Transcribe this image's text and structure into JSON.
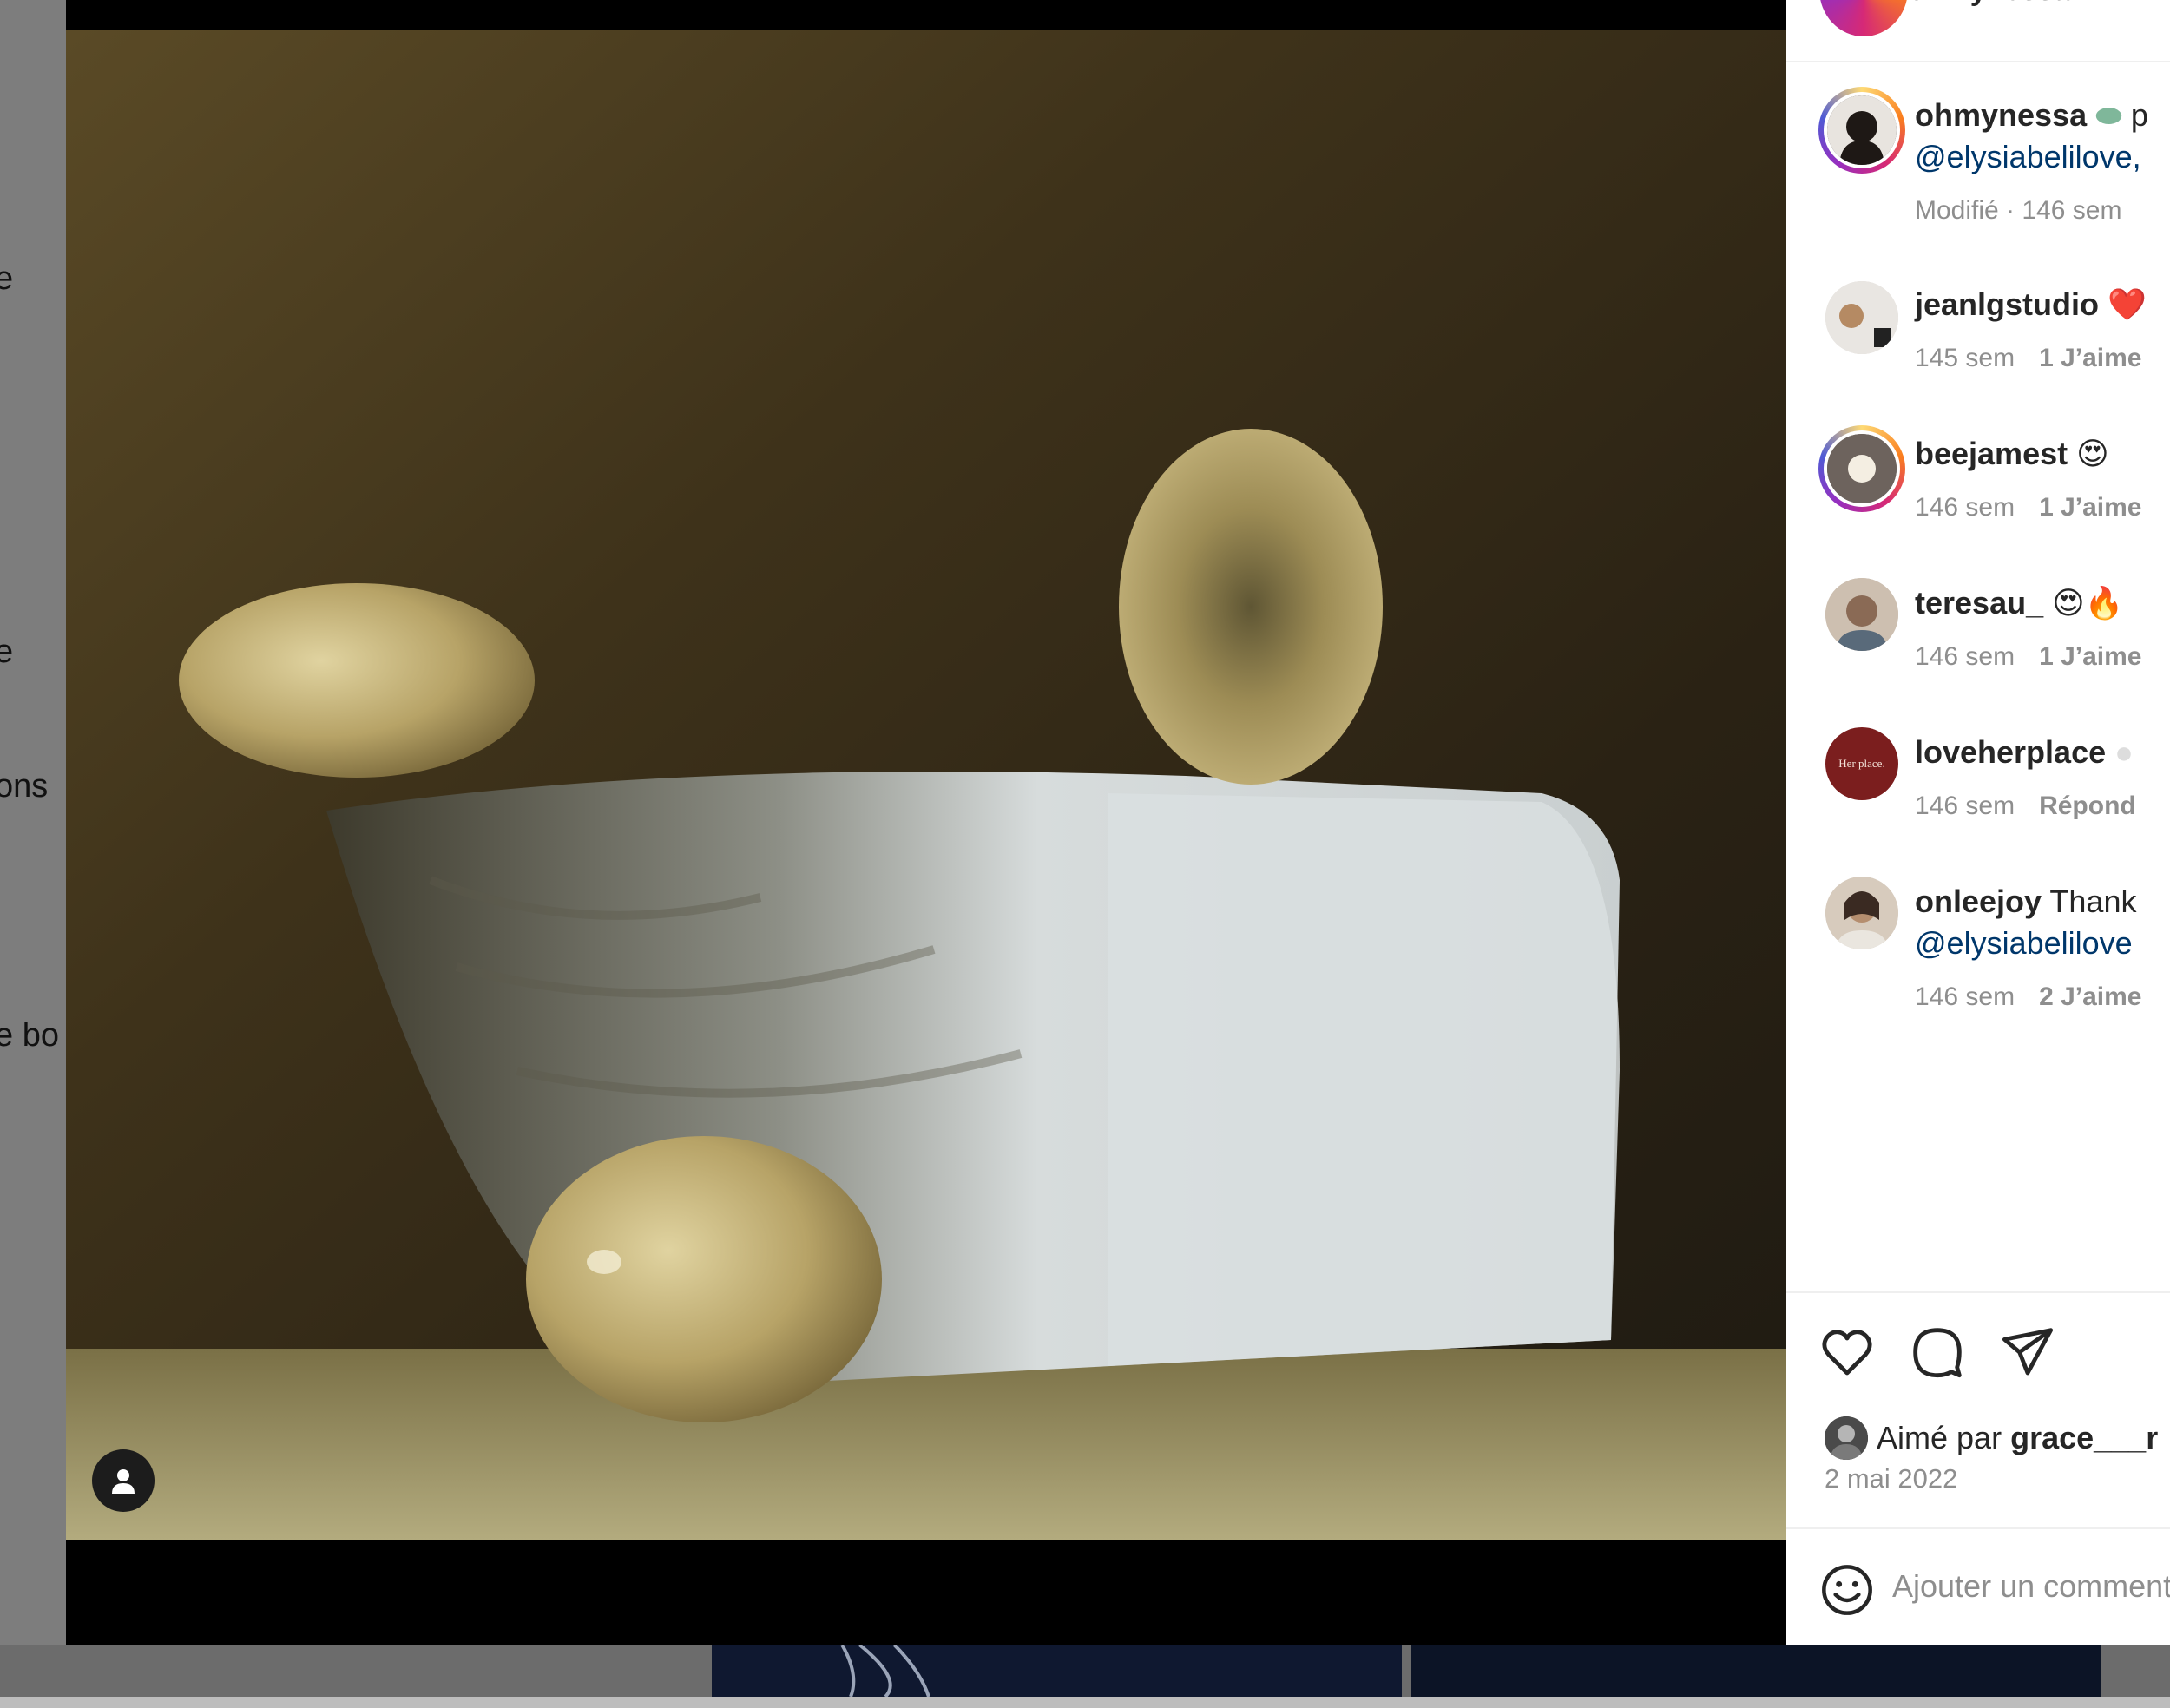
{
  "background": {
    "snippets": [
      "e",
      "e",
      "ons",
      "e bo"
    ]
  },
  "header": {
    "username": "ohmynessa"
  },
  "caption": {
    "username": "ohmynessa",
    "text_tail": "p",
    "mention": "@elysiabelilove,",
    "meta": "Modifié · 146 sem"
  },
  "comments": [
    {
      "username": "jeanlgstudio",
      "emoji": "❤️",
      "time": "145 sem",
      "action": "1 J’aime"
    },
    {
      "username": "beejamest",
      "emoji": "😍",
      "time": "146 sem",
      "action": "1 J’aime"
    },
    {
      "username": "teresau_",
      "emoji": "😍🔥",
      "time": "146 sem",
      "action": "1 J’aime"
    },
    {
      "username": "loveherplace",
      "emoji": "",
      "time": "146 sem",
      "action": "Répond",
      "avatar_text": "Her place."
    },
    {
      "username": "onleejoy",
      "text": "Thank",
      "mention": "@elysiabelilove",
      "time": "146 sem",
      "action": "2 J’aime"
    }
  ],
  "likes": {
    "prefix": "Aimé par",
    "user": "grace___r"
  },
  "post_date": "2 mai 2022",
  "add_comment": {
    "placeholder": "Ajouter un commentaire…"
  },
  "colors": {
    "ring_gradient": [
      "#feda75",
      "#fa7e1e",
      "#d62976",
      "#962fbf"
    ],
    "mention": "#00376b",
    "secondary_text": "#8e8e8e"
  }
}
